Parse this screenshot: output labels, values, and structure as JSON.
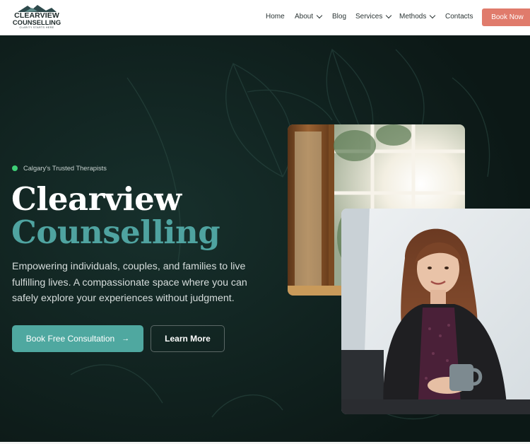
{
  "brand": {
    "line1": "CLEARVIEW",
    "line2": "COUNSELLING",
    "tagline": "CLARITY STARTS HERE"
  },
  "nav": {
    "home": "Home",
    "about": "About",
    "blog": "Blog",
    "services": "Services",
    "methods": "Methods",
    "contacts": "Contacts",
    "cta": "Book Now"
  },
  "hero": {
    "badge": "Calgary's Trusted Therapists",
    "title_line1": "Clearview",
    "title_line2": "Counselling",
    "description": "Empowering individuals, couples, and families to live fulfilling lives. A compassionate space where you can safely explore your experiences without judgment.",
    "primary_button": "Book Free Consultation",
    "primary_arrow": "→",
    "secondary_button": "Learn More"
  },
  "colors": {
    "accent": "#e07b6c",
    "teal": "#4fa8a0",
    "hero_bg": "#0f1d1b",
    "badge_dot": "#3ecf76"
  }
}
